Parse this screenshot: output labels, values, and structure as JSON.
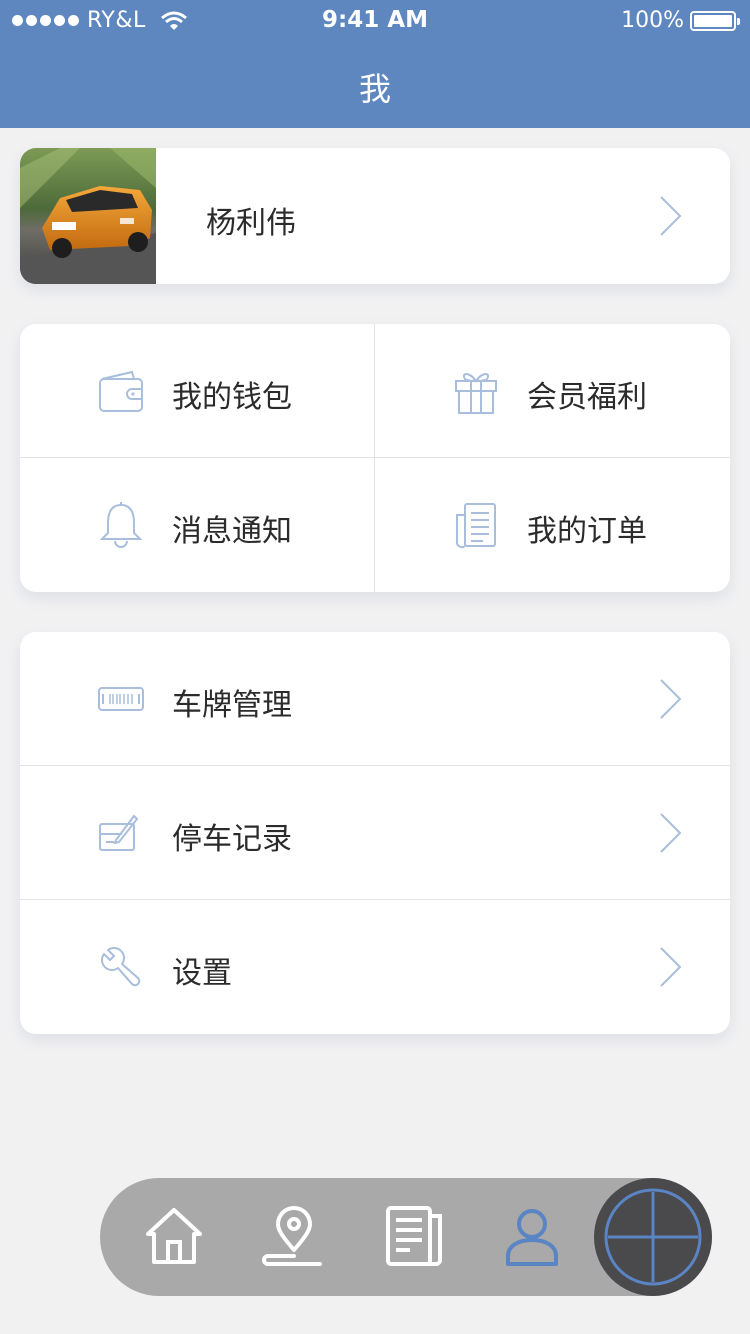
{
  "status_bar": {
    "carrier": "RY&L",
    "time": "9:41 AM",
    "battery": "100%"
  },
  "header": {
    "title": "我"
  },
  "profile": {
    "name": "杨利伟",
    "avatar_icon": "car-photo"
  },
  "grid_menu": [
    {
      "label": "我的钱包",
      "icon": "wallet-icon"
    },
    {
      "label": "会员福利",
      "icon": "gift-icon"
    },
    {
      "label": "消息通知",
      "icon": "bell-icon"
    },
    {
      "label": "我的订单",
      "icon": "order-list-icon"
    }
  ],
  "list_menu": [
    {
      "label": "车牌管理",
      "icon": "license-plate-icon"
    },
    {
      "label": "停车记录",
      "icon": "parking-record-icon"
    },
    {
      "label": "设置",
      "icon": "wrench-icon"
    }
  ],
  "tab_bar": {
    "tabs": [
      {
        "icon": "home-icon",
        "active": false
      },
      {
        "icon": "location-pin-icon",
        "active": false
      },
      {
        "icon": "document-icon",
        "active": false
      },
      {
        "icon": "user-icon",
        "active": true
      }
    ],
    "fab_icon": "plus-icon"
  },
  "colors": {
    "header_bg": "#5e87c0",
    "icon_blue": "#a8bedc",
    "tab_active": "#5b84c4",
    "tab_bar_bg": "#a9a9a9",
    "fab_bg": "#4a4a4c"
  }
}
